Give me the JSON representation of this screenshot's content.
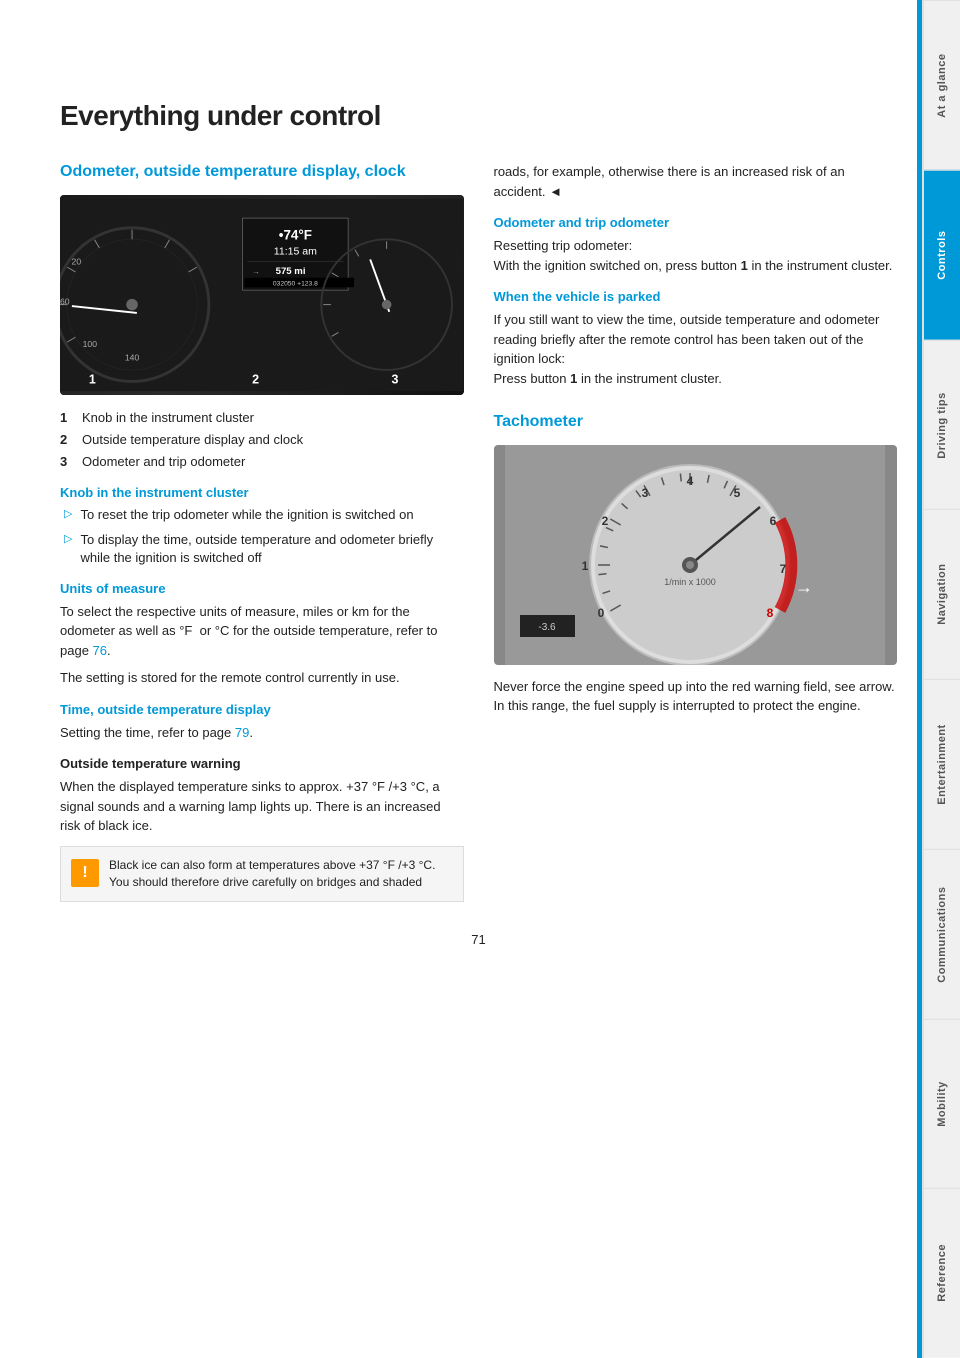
{
  "page": {
    "title": "Everything under control",
    "number": "71"
  },
  "left_section": {
    "heading": "Odometer, outside temperature display, clock",
    "numbered_items": [
      {
        "num": "1",
        "text": "Knob in the instrument cluster"
      },
      {
        "num": "2",
        "text": "Outside temperature display and clock"
      },
      {
        "num": "3",
        "text": "Odometer and trip odometer"
      }
    ],
    "knob_section": {
      "title": "Knob in the instrument cluster",
      "bullets": [
        "To reset the trip odometer while the ignition is switched on",
        "To display the time, outside temperature and odometer briefly while the ignition is switched off"
      ]
    },
    "units_section": {
      "title": "Units of measure",
      "body1": "To select the respective units of measure, miles or km for the odometer as well as °F  or °C for the outside temperature, refer to page 76.",
      "body2": "The setting is stored for the remote control currently in use."
    },
    "time_section": {
      "title": "Time, outside temperature display",
      "body": "Setting the time, refer to page 79."
    },
    "outside_temp": {
      "title": "Outside temperature warning",
      "body": "When the displayed temperature sinks to approx. +37 °F /+3 °C, a signal sounds and a warning lamp lights up. There is an increased risk of black ice.",
      "warning_text": "Black ice can also form at temperatures above +37 °F /+3 °C. You should therefore drive carefully on bridges and shaded"
    }
  },
  "right_section": {
    "intro_text": "roads, for example, otherwise there is an increased risk of an accident.",
    "odometer_section": {
      "title": "Odometer and trip odometer",
      "body": "Resetting trip odometer:\nWith the ignition switched on, press button 1 in the instrument cluster."
    },
    "parked_section": {
      "title": "When the vehicle is parked",
      "body": "If you still want to view the time, outside temperature and odometer reading briefly after the remote control has been taken out of the ignition lock:\nPress button 1 in the instrument cluster."
    },
    "tachometer_section": {
      "title": "Tachometer",
      "body": "Never force the engine speed up into the red warning field, see arrow. In this range, the fuel supply is interrupted to protect the engine."
    }
  },
  "display": {
    "temp": "•74°F",
    "time": "11:15 am",
    "miles": "575 mi",
    "total": "032050 +123.8"
  },
  "sidebar": {
    "tabs": [
      {
        "label": "At a glance",
        "active": false
      },
      {
        "label": "Controls",
        "active": true
      },
      {
        "label": "Driving tips",
        "active": false
      },
      {
        "label": "Navigation",
        "active": false
      },
      {
        "label": "Entertainment",
        "active": false
      },
      {
        "label": "Communications",
        "active": false
      },
      {
        "label": "Mobility",
        "active": false
      },
      {
        "label": "Reference",
        "active": false
      }
    ]
  },
  "icons": {
    "warning": "!",
    "bullet_arrow": "▷"
  }
}
